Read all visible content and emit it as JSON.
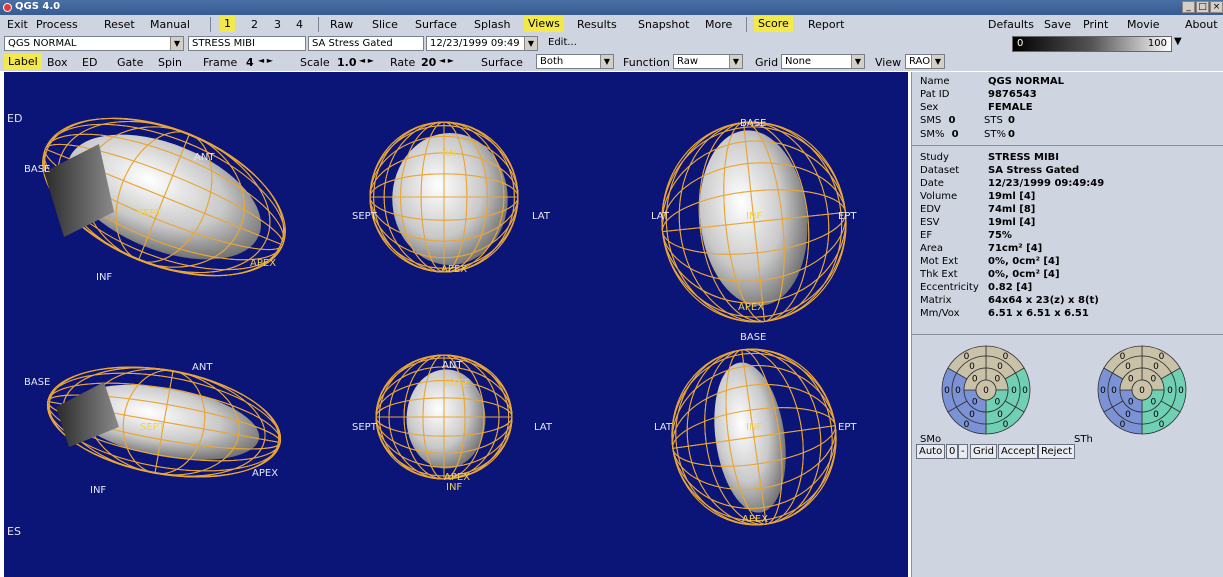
{
  "window": {
    "title": "QGS 4.0",
    "controls": [
      "_",
      "□",
      "×"
    ]
  },
  "menu": {
    "items": [
      "Exit",
      "Process",
      "Reset",
      "Manual"
    ],
    "frames": [
      "1",
      "2",
      "3",
      "4"
    ],
    "views": [
      "Raw",
      "Slice",
      "Surface",
      "Splash",
      "Views",
      "Results",
      "Snapshot",
      "More"
    ],
    "score": [
      "Score",
      "Report"
    ],
    "right": [
      "Defaults",
      "Save",
      "Print",
      "Movie",
      "About"
    ]
  },
  "dataset": {
    "patient": "QGS NORMAL",
    "study": "STRESS MIBI",
    "dataset": "SA Stress Gated",
    "date": "12/23/1999 09:49",
    "edit": "Edit...",
    "scale_min": "0",
    "scale_max": "100"
  },
  "options": {
    "label": "Label",
    "box": "Box",
    "ed": "ED",
    "gate": "Gate",
    "spin": "Spin",
    "frame_label": "Frame",
    "frame_value": "4",
    "scale_label": "Scale",
    "scale_value": "1.0",
    "rate_label": "Rate",
    "rate_value": "20",
    "surface_label": "Surface",
    "surface_value": "Both",
    "function_label": "Function",
    "function_value": "Raw",
    "grid_label": "Grid",
    "grid_value": "None",
    "view_label": "View",
    "view_value": "RAO"
  },
  "viewport": {
    "ed": "ED",
    "es": "ES",
    "labels": {
      "base": "BASE",
      "ant": "ANT",
      "sept": "SEPT",
      "inf": "INF",
      "apex": "APEX",
      "lat": "LAT",
      "ept": "EPT"
    }
  },
  "patient_info": [
    {
      "key": "Name",
      "value": "QGS NORMAL"
    },
    {
      "key": "Pat ID",
      "value": "9876543"
    },
    {
      "key": "Sex",
      "value": "FEMALE"
    }
  ],
  "scores": {
    "sms_label": "SMS",
    "sms_value": "0",
    "sts_label": "STS",
    "sts_value": "0",
    "smp_label": "SM%",
    "smp_value": "0",
    "stp_label": "ST%",
    "stp_value": "0"
  },
  "study_info": [
    {
      "key": "Study",
      "value": "STRESS MIBI"
    },
    {
      "key": "Dataset",
      "value": "SA Stress Gated"
    },
    {
      "key": "Date",
      "value": "12/23/1999 09:49:49"
    },
    {
      "key": "Volume",
      "value": "19ml [4]"
    },
    {
      "key": "EDV",
      "value": "74ml [8]"
    },
    {
      "key": "ESV",
      "value": "19ml [4]"
    },
    {
      "key": "EF",
      "value": "75%"
    },
    {
      "key": "Area",
      "value": "71cm² [4]"
    },
    {
      "key": "Mot Ext",
      "value": "0%, 0cm² [4]"
    },
    {
      "key": "Thk Ext",
      "value": "0%, 0cm² [4]"
    },
    {
      "key": "Eccentricity",
      "value": "0.82 [4]"
    },
    {
      "key": "Matrix",
      "value": "64x64 x 23(z) x 8(t)"
    },
    {
      "key": "Mm/Vox",
      "value": "6.51 x 6.51 x 6.51"
    }
  ],
  "polar_maps": {
    "smo_label": "SMo",
    "sth_label": "STh",
    "segment_value": "0",
    "colors": {
      "tan": "#c9c2a8",
      "blue": "#7b93d6",
      "teal": "#6fd0b4"
    }
  },
  "buttons": [
    "Auto",
    "0",
    "-",
    "Grid",
    "Accept",
    "Reject"
  ],
  "colors": {
    "highlight": "#f4e94a",
    "viewport_bg": "#0b1477",
    "mesh": "#e8a63a",
    "panel_bg": "#cfd4e1"
  }
}
